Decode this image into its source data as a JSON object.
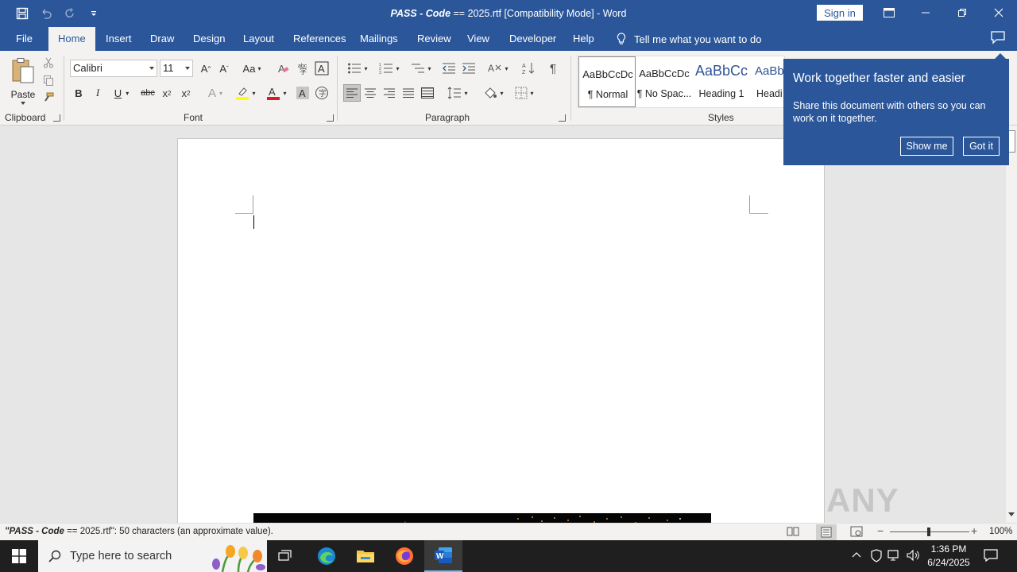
{
  "window": {
    "title_prefix": "PASS - Code",
    "title_rest": " == 2025.rtf [Compatibility Mode]  -  Word",
    "sign_in": "Sign in"
  },
  "tabs": [
    "File",
    "Home",
    "Insert",
    "Draw",
    "Design",
    "Layout",
    "References",
    "Mailings",
    "Review",
    "View",
    "Developer",
    "Help"
  ],
  "tell_me": "Tell me what you want to do",
  "ribbon": {
    "clipboard": {
      "paste": "Paste",
      "label": "Clipboard"
    },
    "font": {
      "name": "Calibri",
      "size": "11",
      "label": "Font"
    },
    "paragraph": {
      "label": "Paragraph"
    },
    "styles": {
      "label": "Styles",
      "items": [
        {
          "preview": "AaBbCcDc",
          "name": "¶ Normal"
        },
        {
          "preview": "AaBbCcDc",
          "name": "¶ No Spac..."
        },
        {
          "preview": "AaBbCc",
          "name": "Heading 1"
        },
        {
          "preview": "AaBbC",
          "name": "Headi"
        }
      ]
    }
  },
  "popup": {
    "title": "Work together faster and easier",
    "body": "Share this document with others so you can work on it together.",
    "show_me": "Show me",
    "got_it": "Got it"
  },
  "status": {
    "name_prefix": "\"PASS - Code",
    "text_rest": " == 2025.rtf\": 50 characters (an approximate value).",
    "zoom": "100%"
  },
  "watermark": "ANY RUN",
  "taskbar": {
    "search_placeholder": "Type here to search",
    "time": "1:36 PM",
    "date": "6/24/2025"
  },
  "colors": {
    "word_blue": "#2b579a",
    "ribbon_bg": "#f3f2f1",
    "taskbar": "#1f1f1f"
  }
}
